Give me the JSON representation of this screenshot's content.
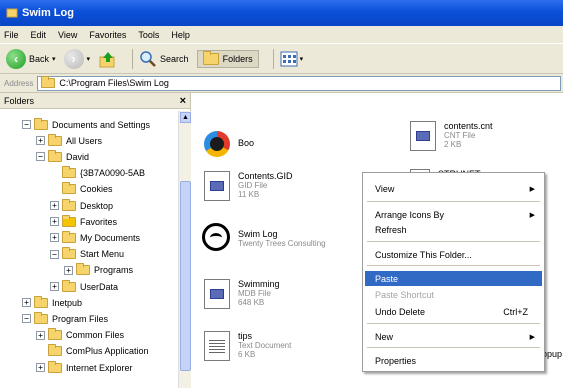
{
  "window": {
    "title": "Swim Log"
  },
  "menubar": [
    "File",
    "Edit",
    "View",
    "Favorites",
    "Tools",
    "Help"
  ],
  "toolbar": {
    "back": "Back",
    "search": "Search",
    "folders": "Folders"
  },
  "address": {
    "label": "Address",
    "path": "C:\\Program Files\\Swim Log"
  },
  "folders_pane": {
    "title": "Folders",
    "close": "×",
    "tree": [
      {
        "label": "Documents and Settings",
        "expander": "−",
        "indent": 0
      },
      {
        "label": "All Users",
        "expander": "+",
        "indent": 1
      },
      {
        "label": "David",
        "expander": "−",
        "indent": 1
      },
      {
        "label": "{3B7A0090-5AB",
        "expander": "",
        "indent": 2
      },
      {
        "label": "Cookies",
        "expander": "",
        "indent": 2
      },
      {
        "label": "Desktop",
        "expander": "+",
        "indent": 2
      },
      {
        "label": "Favorites",
        "expander": "+",
        "indent": 2
      },
      {
        "label": "My Documents",
        "expander": "+",
        "indent": 2
      },
      {
        "label": "Start Menu",
        "expander": "−",
        "indent": 2
      },
      {
        "label": "Programs",
        "expander": "+",
        "indent": 3
      },
      {
        "label": "UserData",
        "expander": "+",
        "indent": 2
      },
      {
        "label": "Inetpub",
        "expander": "+",
        "indent": 0
      },
      {
        "label": "Program Files",
        "expander": "−",
        "indent": 0
      },
      {
        "label": "Common Files",
        "expander": "+",
        "indent": 1
      },
      {
        "label": "ComPlus Application",
        "expander": "",
        "indent": 1
      },
      {
        "label": "Internet Explorer",
        "expander": "+",
        "indent": 1
      }
    ]
  },
  "files": [
    {
      "name": "Boo",
      "type": "",
      "size": "",
      "icon": "media-icon"
    },
    {
      "name": "contents.cnt",
      "type": "CNT File",
      "size": "2 KB",
      "icon": "help-file-icon"
    },
    {
      "name": "Contents.GID",
      "type": "GID File",
      "size": "11 KB",
      "icon": "gid-file-icon"
    },
    {
      "name": "STRUNET",
      "type": "",
      "size": "",
      "icon": "file-icon"
    },
    {
      "name": "Swim Log",
      "type": "Twenty Trees Consulting",
      "size": "",
      "icon": "swim-log-app-icon"
    },
    {
      "name": "Swimming",
      "type": "MDB File",
      "size": "648 KB",
      "icon": "database-file-icon"
    },
    {
      "name": "tips",
      "type": "Text Document",
      "size": "6 KB",
      "icon": "text-file-icon"
    },
    {
      "name": "popup",
      "type": "",
      "size": "",
      "icon": "file-icon"
    }
  ],
  "context_menu": {
    "items": [
      {
        "label": "View",
        "arrow": "▶",
        "disabled": false,
        "highlighted": false
      },
      {
        "label": "Arrange Icons By",
        "arrow": "▶",
        "disabled": false,
        "highlighted": false
      },
      {
        "label": "Refresh",
        "arrow": "",
        "disabled": false,
        "highlighted": false
      },
      {
        "label": "Customize This Folder...",
        "arrow": "",
        "disabled": false,
        "highlighted": false
      },
      {
        "label": "Paste",
        "arrow": "",
        "disabled": false,
        "highlighted": true
      },
      {
        "label": "Paste Shortcut",
        "arrow": "",
        "disabled": true,
        "highlighted": false
      },
      {
        "label": "Undo Delete",
        "shortcut": "Ctrl+Z",
        "arrow": "",
        "disabled": false,
        "highlighted": false
      },
      {
        "label": "New",
        "arrow": "▶",
        "disabled": false,
        "highlighted": false
      },
      {
        "label": "Properties",
        "arrow": "",
        "disabled": false,
        "highlighted": false
      }
    ]
  }
}
